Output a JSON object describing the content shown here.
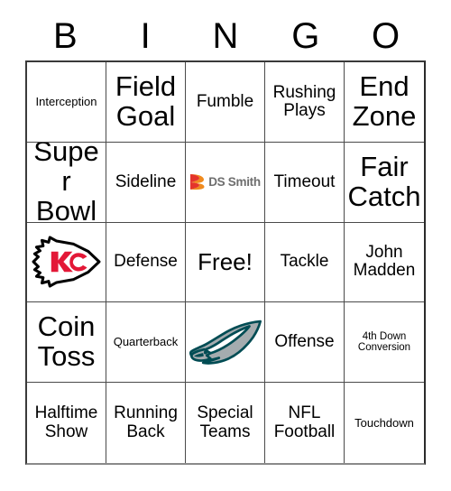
{
  "header": {
    "letters": [
      "B",
      "I",
      "N",
      "G",
      "O"
    ]
  },
  "colors": {
    "grid_border": "#4a4a4a",
    "text": "#000000",
    "dssmith_orange": "#f08a1e",
    "dssmith_red": "#e4342b",
    "dssmith_gray": "#6e6e6e",
    "chiefs_red": "#e31837",
    "chiefs_outline": "#000000",
    "eagles_green": "#004c54",
    "eagles_silver": "#a5acaf"
  },
  "grid": {
    "rows": 5,
    "columns": 5,
    "cells": [
      {
        "type": "text",
        "label": "Interception",
        "size": "sm"
      },
      {
        "type": "text",
        "label": "Field Goal",
        "size": "xl"
      },
      {
        "type": "text",
        "label": "Fumble",
        "size": "md"
      },
      {
        "type": "text",
        "label": "Rushing Plays",
        "size": "md"
      },
      {
        "type": "text",
        "label": "End Zone",
        "size": "xl"
      },
      {
        "type": "text",
        "label": "Super Bowl",
        "size": "xl"
      },
      {
        "type": "text",
        "label": "Sideline",
        "size": "md"
      },
      {
        "type": "logo",
        "label": "DS Smith",
        "logo": "ds-smith-logo"
      },
      {
        "type": "text",
        "label": "Timeout",
        "size": "md"
      },
      {
        "type": "text",
        "label": "Fair Catch",
        "size": "xl"
      },
      {
        "type": "logo",
        "label": "Kansas City Chiefs",
        "logo": "chiefs-logo"
      },
      {
        "type": "text",
        "label": "Defense",
        "size": "md"
      },
      {
        "type": "text",
        "label": "Free!",
        "size": "lg"
      },
      {
        "type": "text",
        "label": "Tackle",
        "size": "md"
      },
      {
        "type": "text",
        "label": "John Madden",
        "size": "md"
      },
      {
        "type": "text",
        "label": "Coin Toss",
        "size": "xl"
      },
      {
        "type": "text",
        "label": "Quarterback",
        "size": "sm"
      },
      {
        "type": "logo",
        "label": "Philadelphia Eagles",
        "logo": "eagles-logo"
      },
      {
        "type": "text",
        "label": "Offense",
        "size": "md"
      },
      {
        "type": "text",
        "label": "4th Down Conversion",
        "size": "xs"
      },
      {
        "type": "text",
        "label": "Halftime Show",
        "size": "md"
      },
      {
        "type": "text",
        "label": "Running Back",
        "size": "md"
      },
      {
        "type": "text",
        "label": "Special Teams",
        "size": "md"
      },
      {
        "type": "text",
        "label": "NFL Football",
        "size": "md"
      },
      {
        "type": "text",
        "label": "Touchdown",
        "size": "sm"
      }
    ]
  }
}
